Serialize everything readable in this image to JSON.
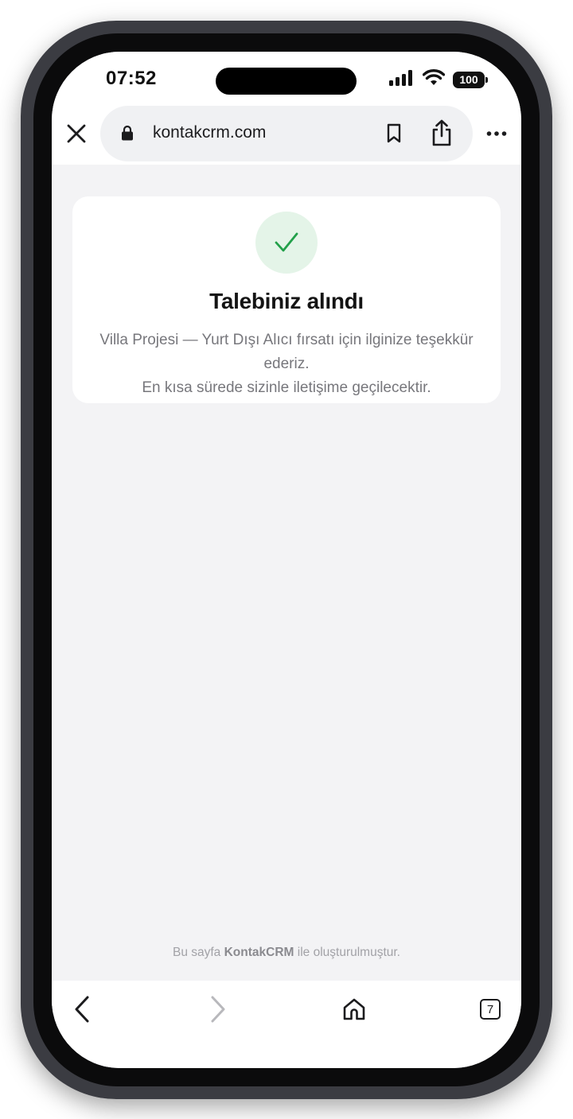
{
  "status_bar": {
    "time": "07:52",
    "battery": "100",
    "icons": [
      "cellular-signal-icon",
      "wifi-icon",
      "battery-icon"
    ]
  },
  "browser": {
    "url": "kontakcrm.com",
    "icons": [
      "close-icon",
      "lock-icon",
      "bookmark-icon",
      "share-icon",
      "more-icon"
    ]
  },
  "confirmation": {
    "icon": "checkmark-icon",
    "title": "Talebiniz alındı",
    "message_line1": "Villa Projesi — Yurt Dışı Alıcı fırsatı için ilginize teşekkür ederiz.",
    "message_line2": "En kısa sürede sizinle iletişime geçilecektir."
  },
  "footer": {
    "prefix": "Bu sayfa",
    "brand": "KontakCRM",
    "suffix": "ile oluşturulmuştur."
  },
  "toolbar": {
    "tabs_count": "7",
    "icons": [
      "back-icon",
      "forward-icon",
      "home-icon",
      "tabs-icon"
    ]
  },
  "colors": {
    "accent_green": "#22a04a",
    "check_bg": "#e4f4e8",
    "page_bg": "#f3f3f5"
  }
}
